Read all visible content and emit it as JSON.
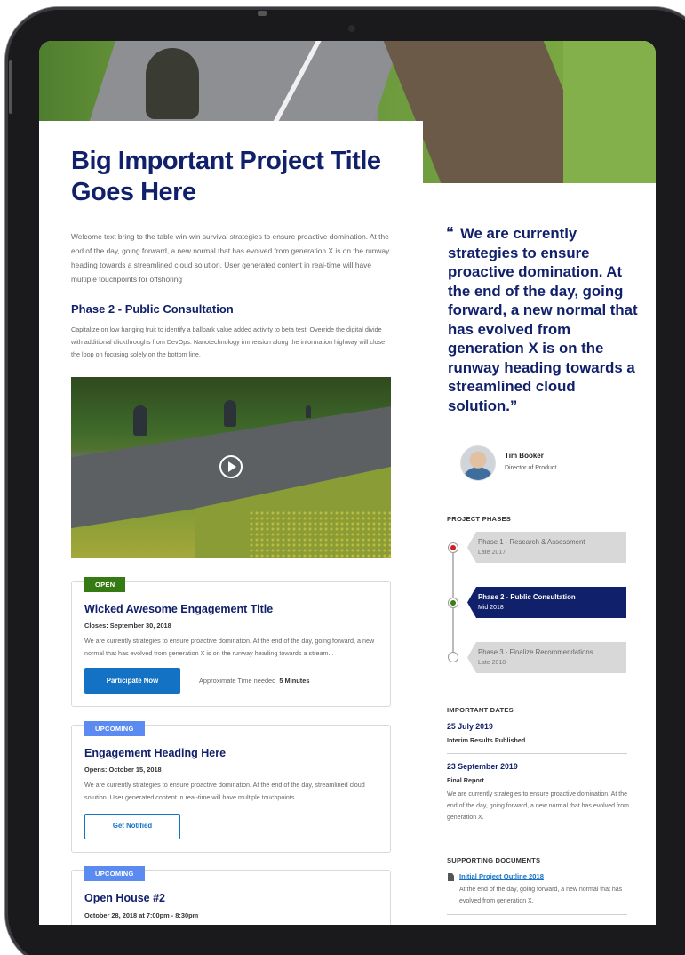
{
  "page": {
    "title": "Big Important Project Title Goes Here",
    "intro": "Welcome text bring to the table win-win survival strategies to ensure proactive domination. At the end of the day, going forward, a new normal that has evolved from generation X is on the runway heading towards a streamlined cloud solution. User generated content in real-time will have multiple touchpoints for offshoring",
    "phase_heading": "Phase 2 - Public Consultation",
    "phase_text": "Capitalize on low hanging fruit to identify a ballpark value added activity to beta test. Override the digital divide with additional clickthroughs from DevOps. Nanotechnology immersion along the information highway will close the loop on focusing solely on the bottom line."
  },
  "engagements": [
    {
      "badge": "OPEN",
      "title": "Wicked Awesome Engagement Title",
      "date": "Closes: September 30, 2018",
      "text": "We are currently strategies to ensure proactive domination. At the end of the day, going forward, a new normal that has evolved from generation X is on the runway heading towards a stream...",
      "button": "Participate Now",
      "time_label": "Approximate Time needed",
      "time_value": "5 Minutes"
    },
    {
      "badge": "UPCOMING",
      "title": "Engagement Heading Here",
      "date": "Opens: October 15, 2018",
      "text": "We are currently strategies to ensure proactive domination. At the end of the day, streamlined cloud solution. User generated content in real-time will have multiple touchpoints...",
      "button": "Get Notified"
    },
    {
      "badge": "UPCOMING",
      "title": "Open House #2",
      "date": "October 28, 2018 at 7:00pm - 8:30pm"
    }
  ],
  "quote": {
    "mark": "“",
    "text": "We are currently strategies to ensure proactive domination. At the end of the day, going forward, a new normal that has evolved from generation X is on the runway heading towards a streamlined cloud solution.”",
    "author": "Tim Booker",
    "role": "Director of Product"
  },
  "phases": {
    "heading": "PROJECT PHASES",
    "items": [
      {
        "name": "Phase 1 - Research & Assessment",
        "when": "Late 2017",
        "status_color": "#d21f1f"
      },
      {
        "name": "Phase 2 - Public Consultation",
        "when": "Mid 2018",
        "status_color": "#3a7f13"
      },
      {
        "name": "Phase 3 - Finalize Recommendations",
        "when": "Late 2018",
        "status_color": ""
      }
    ]
  },
  "important_dates": {
    "heading": "IMPORTANT DATES",
    "items": [
      {
        "date": "25 July 2019",
        "label": "Interim Results Published",
        "text": ""
      },
      {
        "date": "23 September 2019",
        "label": "Final Report",
        "text": "We are currently strategies to ensure proactive domination. At the end of the day, going forward, a new normal that has evolved from generation X."
      }
    ]
  },
  "documents": {
    "heading": "SUPPORTING DOCUMENTS",
    "items": [
      {
        "title": "Initial Project Outline 2018",
        "text": "At the end of the day, going forward, a new normal that has evolved from generation X.",
        "icon": "document-icon"
      }
    ]
  },
  "colors": {
    "navy": "#10206b",
    "link_blue": "#1372c4",
    "open_green": "#357a12",
    "upcoming_blue": "#5b8bf0"
  }
}
